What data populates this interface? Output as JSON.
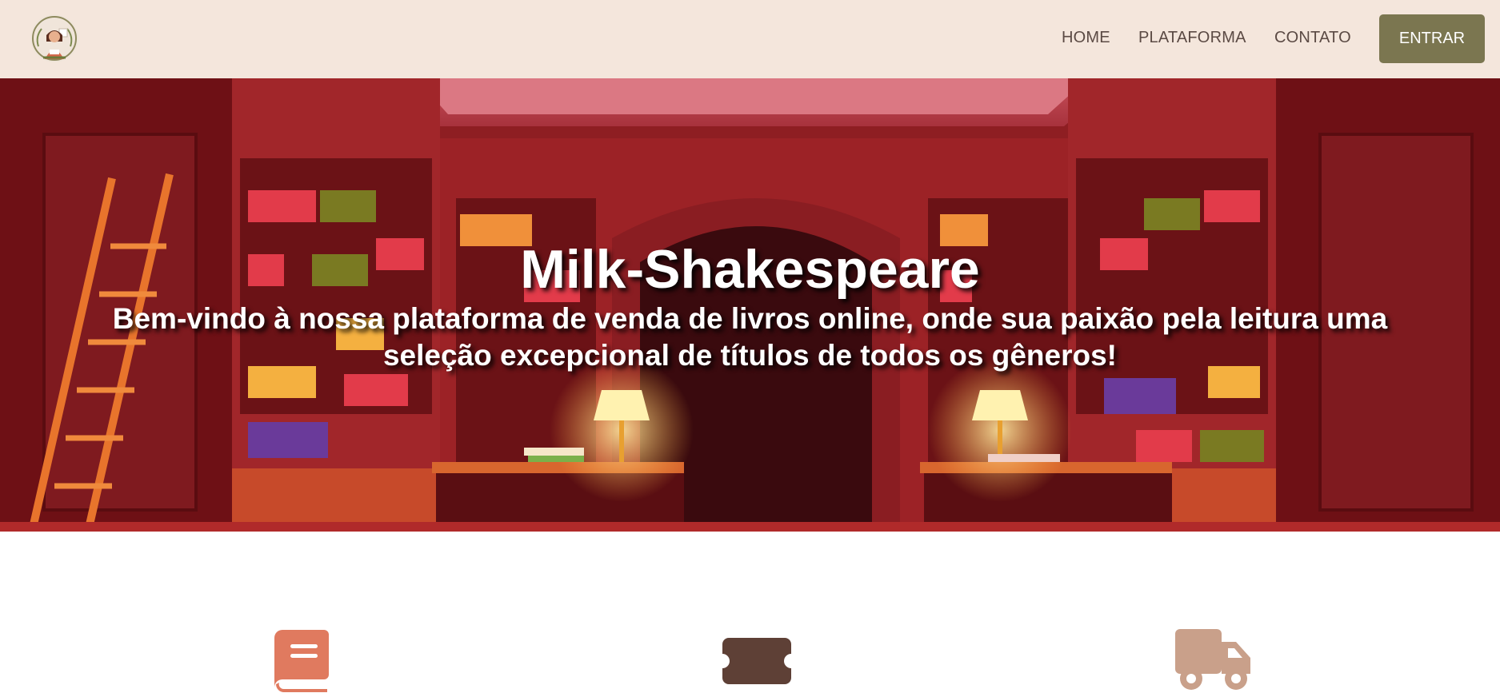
{
  "header": {
    "logo_icon": "reader-avatar-logo",
    "nav": [
      {
        "label": "HOME"
      },
      {
        "label": "PLATAFORMA"
      },
      {
        "label": "CONTATO"
      }
    ],
    "login_button": "ENTRAR"
  },
  "hero": {
    "title": "Milk-Shakespeare",
    "subtitle": "Bem-vindo à nossa plataforma de venda de livros online, onde sua paixão pela leitura uma seleção excepcional de títulos de todos os gêneros!",
    "background": "library-illustration"
  },
  "features": [
    {
      "icon": "book-icon",
      "color": "#e07a5f"
    },
    {
      "icon": "ticket-icon",
      "color": "#5e4036"
    },
    {
      "icon": "truck-icon",
      "color": "#c9a08a"
    }
  ],
  "colors": {
    "header_bg": "#f4e6dc",
    "nav_text": "#5b4a44",
    "button_bg": "#7b7650",
    "button_text": "#ffffff"
  }
}
